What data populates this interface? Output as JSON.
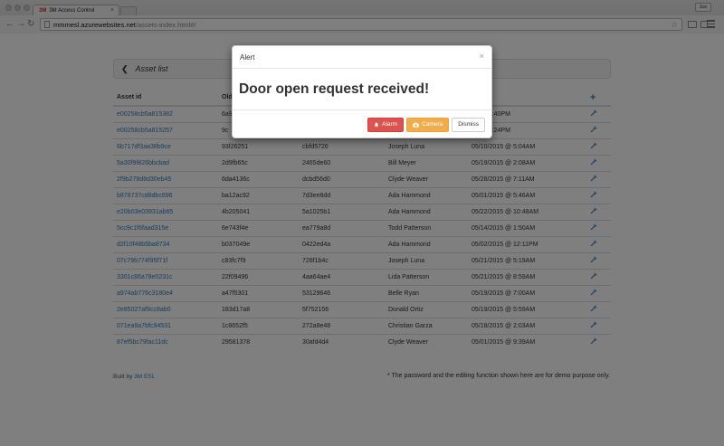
{
  "browser": {
    "tab_title": "3M Access Control",
    "tab_favicon_text": "3M",
    "url_host": "mmmesl.azurewebsites.net",
    "url_path": "/assets-index.html#/",
    "user_label": "Jun"
  },
  "panel": {
    "title": "Asset list"
  },
  "table": {
    "headers": [
      "Asset id",
      "Old",
      "",
      "",
      "d at"
    ],
    "rows": [
      [
        "e00258cb5a815382",
        "6a9",
        "",
        "",
        "15 @ 3:40PM"
      ],
      [
        "e00258cb5a815257",
        "9c",
        "",
        "",
        "15 @ 3:24PM"
      ],
      [
        "6b717df3aa38b9ce",
        "93f26251",
        "cbfd5726",
        "Joseph Luna",
        "05/10/2015 @ 5:04AM"
      ],
      [
        "5a30f9f826bbcbad",
        "2d9fb65c",
        "2465de60",
        "Bill Meyer",
        "05/19/2015 @ 2:08AM"
      ],
      [
        "2f9b278d8d30eb45",
        "6da4136c",
        "dcbd56d0",
        "Clyde Weaver",
        "05/28/2015 @ 7:11AM"
      ],
      [
        "b878737cd8dbc696",
        "ba12ac92",
        "7d3ee8dd",
        "Ada Hammond",
        "05/01/2015 @ 5:46AM"
      ],
      [
        "e20b03e03931ab65",
        "4b205041",
        "5a1025b1",
        "Ada Hammond",
        "05/22/2015 @ 10:48AM"
      ],
      [
        "5cc9c1f6faad315e",
        "6e743f4e",
        "ea779a8d",
        "Todd Patterson",
        "05/14/2015 @ 1:50AM"
      ],
      [
        "d2f10f48b5ba8734",
        "b037049e",
        "0422ed4a",
        "Ada Hammond",
        "05/02/2015 @ 12:11PM"
      ],
      [
        "07c79b774f95f71f",
        "c83fc7f9",
        "726f1b4c",
        "Joseph Luna",
        "05/21/2015 @ 5:19AM"
      ],
      [
        "3301c86a78e0231c",
        "22f09496",
        "4aa64ae4",
        "Lida Patterson",
        "05/21/2015 @ 8:59AM"
      ],
      [
        "a974ab776c3180e4",
        "a47f5301",
        "53129646",
        "Belle Ryan",
        "05/19/2015 @ 7:00AM"
      ],
      [
        "2e85027af9cc8ab0",
        "183d17a8",
        "5f752156",
        "Donald Ortiz",
        "05/19/2015 @ 5:59AM"
      ],
      [
        "071ea9a7bfc94531",
        "1c8652f5",
        "272a8e48",
        "Christian Garza",
        "05/18/2015 @ 2:03AM"
      ],
      [
        "87ef5bc79fac11dc",
        "29581378",
        "30afd4d4",
        "Clyde Weaver",
        "05/01/2015 @ 9:39AM"
      ]
    ]
  },
  "footer": {
    "built_by_prefix": "Built by",
    "built_by_brand": "3M ESL",
    "note": "* The password and the editing function shown here are for demo purpose only."
  },
  "modal": {
    "title": "Alert",
    "close": "×",
    "message": "Door open request received!",
    "alarm_label": "Alarm",
    "camera_label": "Camera",
    "dismiss_label": "Dismiss"
  },
  "colors": {
    "link": "#337ab7",
    "danger": "#d9534f",
    "warning": "#f0ad4e",
    "brand": "#d52b1e"
  },
  "icons": {
    "add": "plus-icon",
    "edit": "wrench-icon",
    "back": "chevron-left-icon",
    "alarm": "bell-icon",
    "camera": "camera-icon"
  }
}
